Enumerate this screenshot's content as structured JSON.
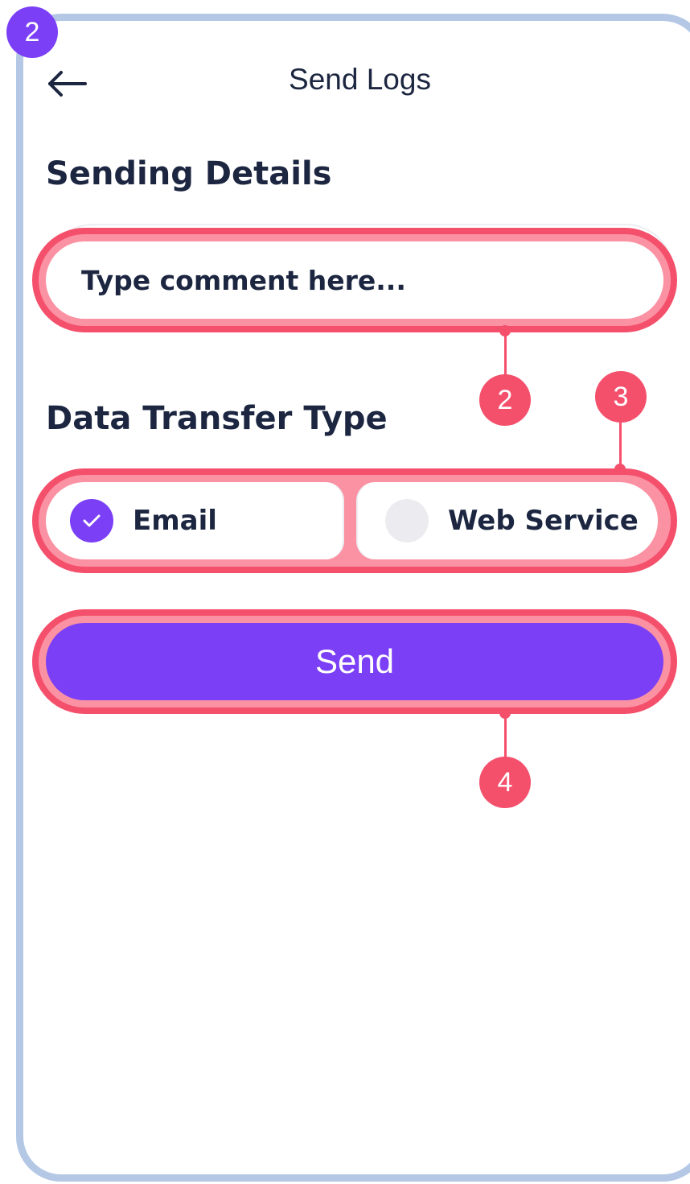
{
  "app": {
    "screen_badge": "2",
    "title": "Send Logs",
    "back_icon": "arrow-left-icon"
  },
  "sending_details": {
    "heading": "Sending Details",
    "comment_placeholder": "Type comment here..."
  },
  "data_transfer": {
    "heading": "Data Transfer Type",
    "options": [
      {
        "label": "Email",
        "selected": true,
        "icon": "check-icon"
      },
      {
        "label": "Web Service",
        "selected": false
      }
    ]
  },
  "actions": {
    "send_label": "Send"
  },
  "annotations": [
    "2",
    "3",
    "4"
  ],
  "colors": {
    "accent": "#7b3ff6",
    "highlight": "#f4506c",
    "frame": "#b4c8e6",
    "text": "#1c2640"
  }
}
